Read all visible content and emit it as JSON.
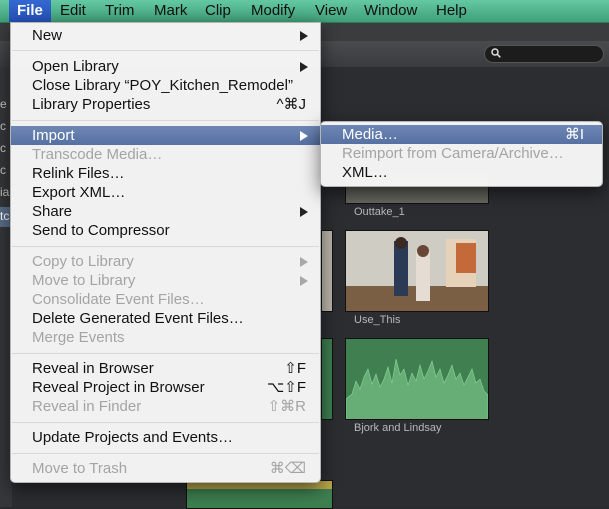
{
  "menubar": {
    "items": [
      {
        "label": "File",
        "active": true
      },
      {
        "label": "Edit"
      },
      {
        "label": "Trim"
      },
      {
        "label": "Mark"
      },
      {
        "label": "Clip"
      },
      {
        "label": "Modify"
      },
      {
        "label": "View"
      },
      {
        "label": "Window"
      },
      {
        "label": "Help"
      }
    ]
  },
  "file_menu": {
    "new": {
      "label": "New"
    },
    "open_library": {
      "label": "Open Library"
    },
    "close_library": {
      "label": "Close Library “POY_Kitchen_Remodel”"
    },
    "library_properties": {
      "label": "Library Properties",
      "shortcut": "^⌘J"
    },
    "import": {
      "label": "Import"
    },
    "transcode_media": {
      "label": "Transcode Media…"
    },
    "relink_files": {
      "label": "Relink Files…"
    },
    "export_xml": {
      "label": "Export XML…"
    },
    "share": {
      "label": "Share"
    },
    "send_to_compressor": {
      "label": "Send to Compressor"
    },
    "copy_to_library": {
      "label": "Copy to Library"
    },
    "move_to_library": {
      "label": "Move to Library"
    },
    "consolidate_event_files": {
      "label": "Consolidate Event Files…"
    },
    "delete_generated_event_files": {
      "label": "Delete Generated Event Files…"
    },
    "merge_events": {
      "label": "Merge Events"
    },
    "reveal_in_browser": {
      "label": "Reveal in Browser",
      "shortcut": "⇧F"
    },
    "reveal_project_in_browser": {
      "label": "Reveal Project in Browser",
      "shortcut": "⌥⇧F"
    },
    "reveal_in_finder": {
      "label": "Reveal in Finder",
      "shortcut": "⇧⌘R"
    },
    "update_projects_and_events": {
      "label": "Update Projects and Events…"
    },
    "move_to_trash": {
      "label": "Move to Trash",
      "shortcut": "⌘⌫"
    }
  },
  "import_submenu": {
    "media": {
      "label": "Media…",
      "shortcut": "⌘I"
    },
    "reimport": {
      "label": "Reimport from Camera/Archive…"
    },
    "xml": {
      "label": "XML…"
    }
  },
  "browser": {
    "clips": [
      {
        "name": "Outtake_1"
      },
      {
        "name": "Use_This"
      },
      {
        "name": "Bjork and Lindsay"
      }
    ]
  },
  "sidebar": {
    "fragments": [
      "e",
      "c",
      "c",
      "c",
      "ia",
      "tc"
    ]
  },
  "colors": {
    "menubar": "#52b68e",
    "highlight": "#5f79aa",
    "menu_bg": "#f8f8f8",
    "disabled_text": "#a4a4a4"
  }
}
